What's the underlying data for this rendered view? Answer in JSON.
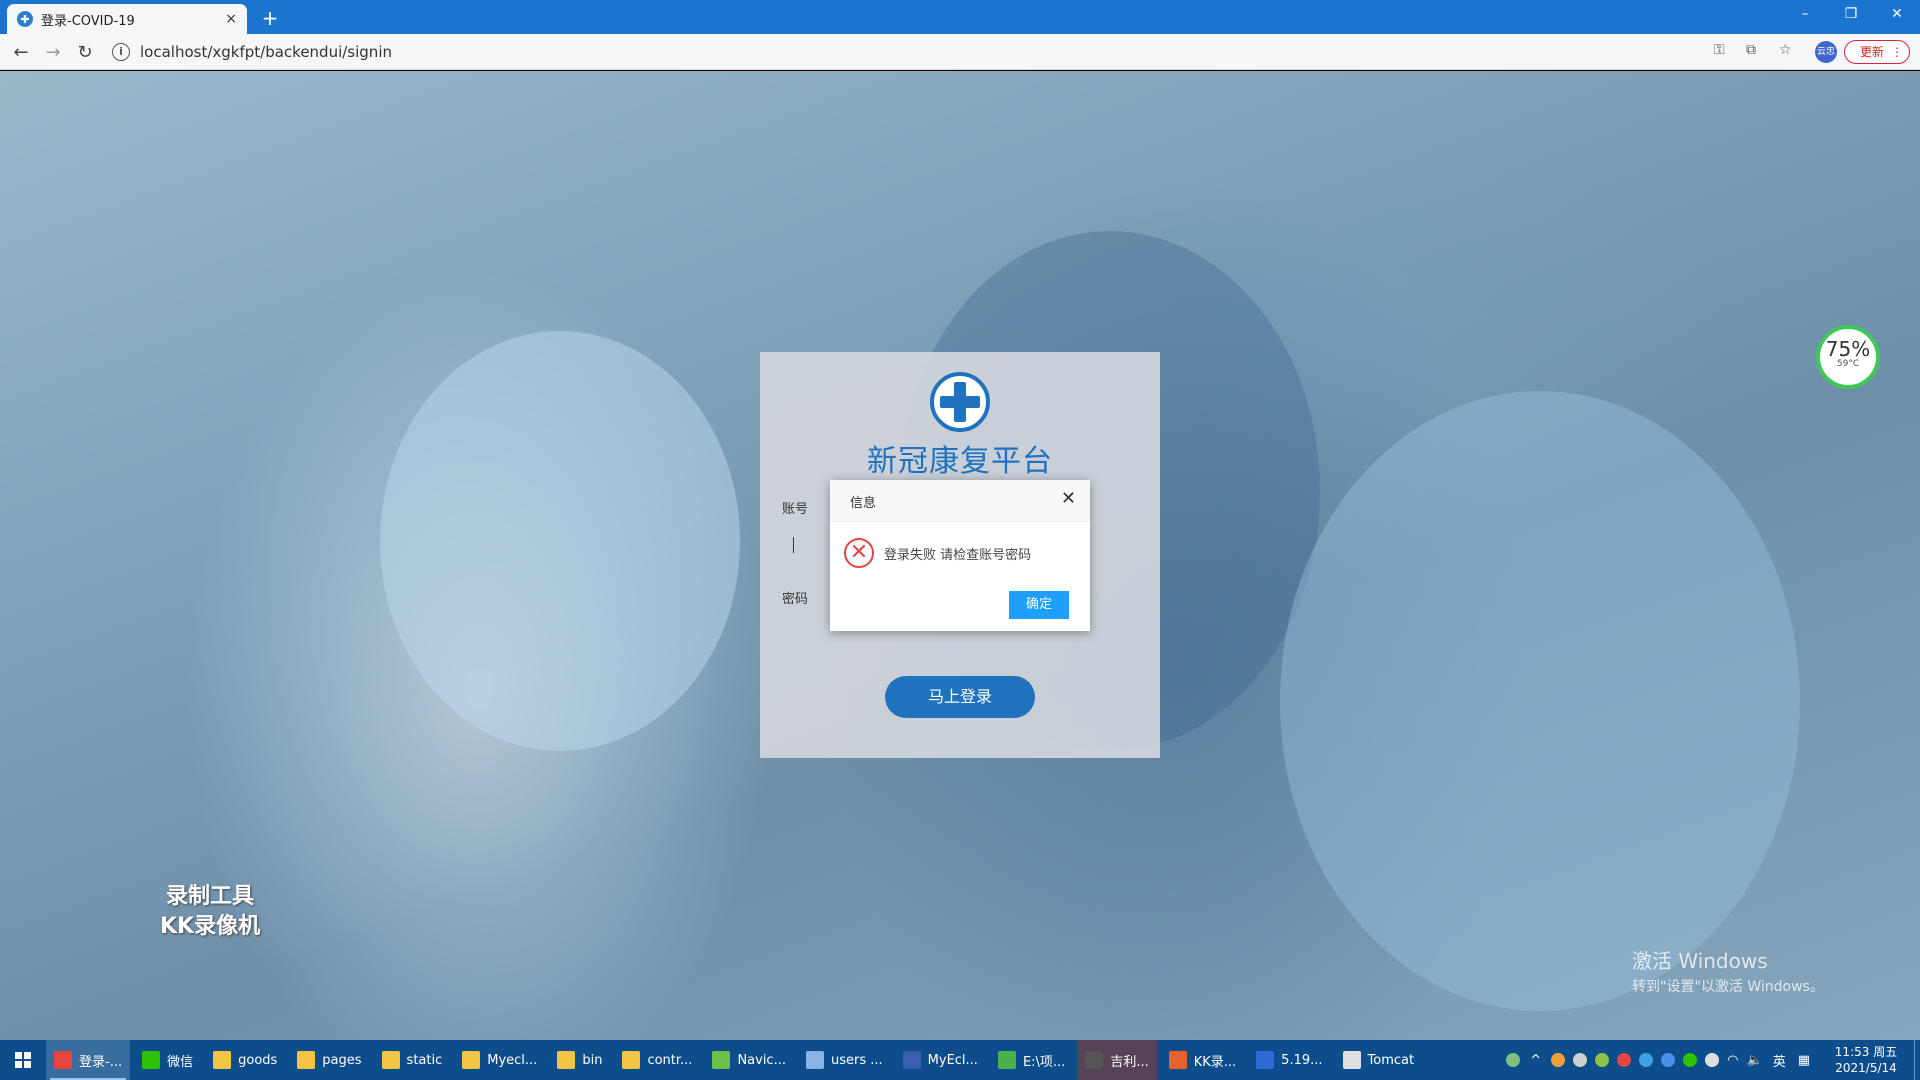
{
  "browser": {
    "tab_title": "登录-COVID-19",
    "tab_close": "×",
    "new_tab": "+",
    "url": "localhost/xgkfpt/backendui/signin",
    "update_label": "更新",
    "profile_label": "云忠",
    "window_controls": {
      "minimize": "–",
      "restore": "❐",
      "close": "✕"
    }
  },
  "login": {
    "platform_title": "新冠康复平台",
    "account_label": "账号",
    "password_label": "密码",
    "login_button": "马上登录"
  },
  "dialog": {
    "title": "信息",
    "close": "✕",
    "message": "登录失败 请检查账号密码",
    "ok_button": "确定",
    "icon": "error-x-icon"
  },
  "overlays": {
    "cpu_percent": "75%",
    "cpu_temp": "59°C",
    "recorder_line1": "录制工具",
    "recorder_line2": "KK录像机",
    "activate_title": "激活 Windows",
    "activate_sub": "转到\"设置\"以激活 Windows。"
  },
  "taskbar": {
    "items": [
      {
        "label": "登录-...",
        "icon": "chrome-icon",
        "color": "#e8453c"
      },
      {
        "label": "微信",
        "icon": "wechat-icon",
        "color": "#2dc100"
      },
      {
        "label": "goods",
        "icon": "folder-icon",
        "color": "#f4c542"
      },
      {
        "label": "pages",
        "icon": "folder-icon",
        "color": "#f4c542"
      },
      {
        "label": "static",
        "icon": "folder-icon",
        "color": "#f4c542"
      },
      {
        "label": "Myecl...",
        "icon": "folder-icon",
        "color": "#f4c542"
      },
      {
        "label": "bin",
        "icon": "folder-icon",
        "color": "#f4c542"
      },
      {
        "label": "contr...",
        "icon": "folder-icon",
        "color": "#f4c542"
      },
      {
        "label": "Navic...",
        "icon": "navicat-icon",
        "color": "#6cc04a"
      },
      {
        "label": "users ...",
        "icon": "table-icon",
        "color": "#8ab4e8"
      },
      {
        "label": "MyEcl...",
        "icon": "myeclipse-icon",
        "color": "#3b5fb0"
      },
      {
        "label": "E:\\项...",
        "icon": "excel-icon",
        "color": "#4caf50"
      },
      {
        "label": "吉利...",
        "icon": "person-icon",
        "color": "#555555"
      },
      {
        "label": "KK录...",
        "icon": "kk-icon",
        "color": "#e8632c"
      },
      {
        "label": "5.19...",
        "icon": "word-icon",
        "color": "#2b6cd4"
      },
      {
        "label": "Tomcat",
        "icon": "java-icon",
        "color": "#e0e0e0"
      }
    ],
    "ime": "英",
    "time": "11:53 周五",
    "date": "2021/5/14"
  }
}
